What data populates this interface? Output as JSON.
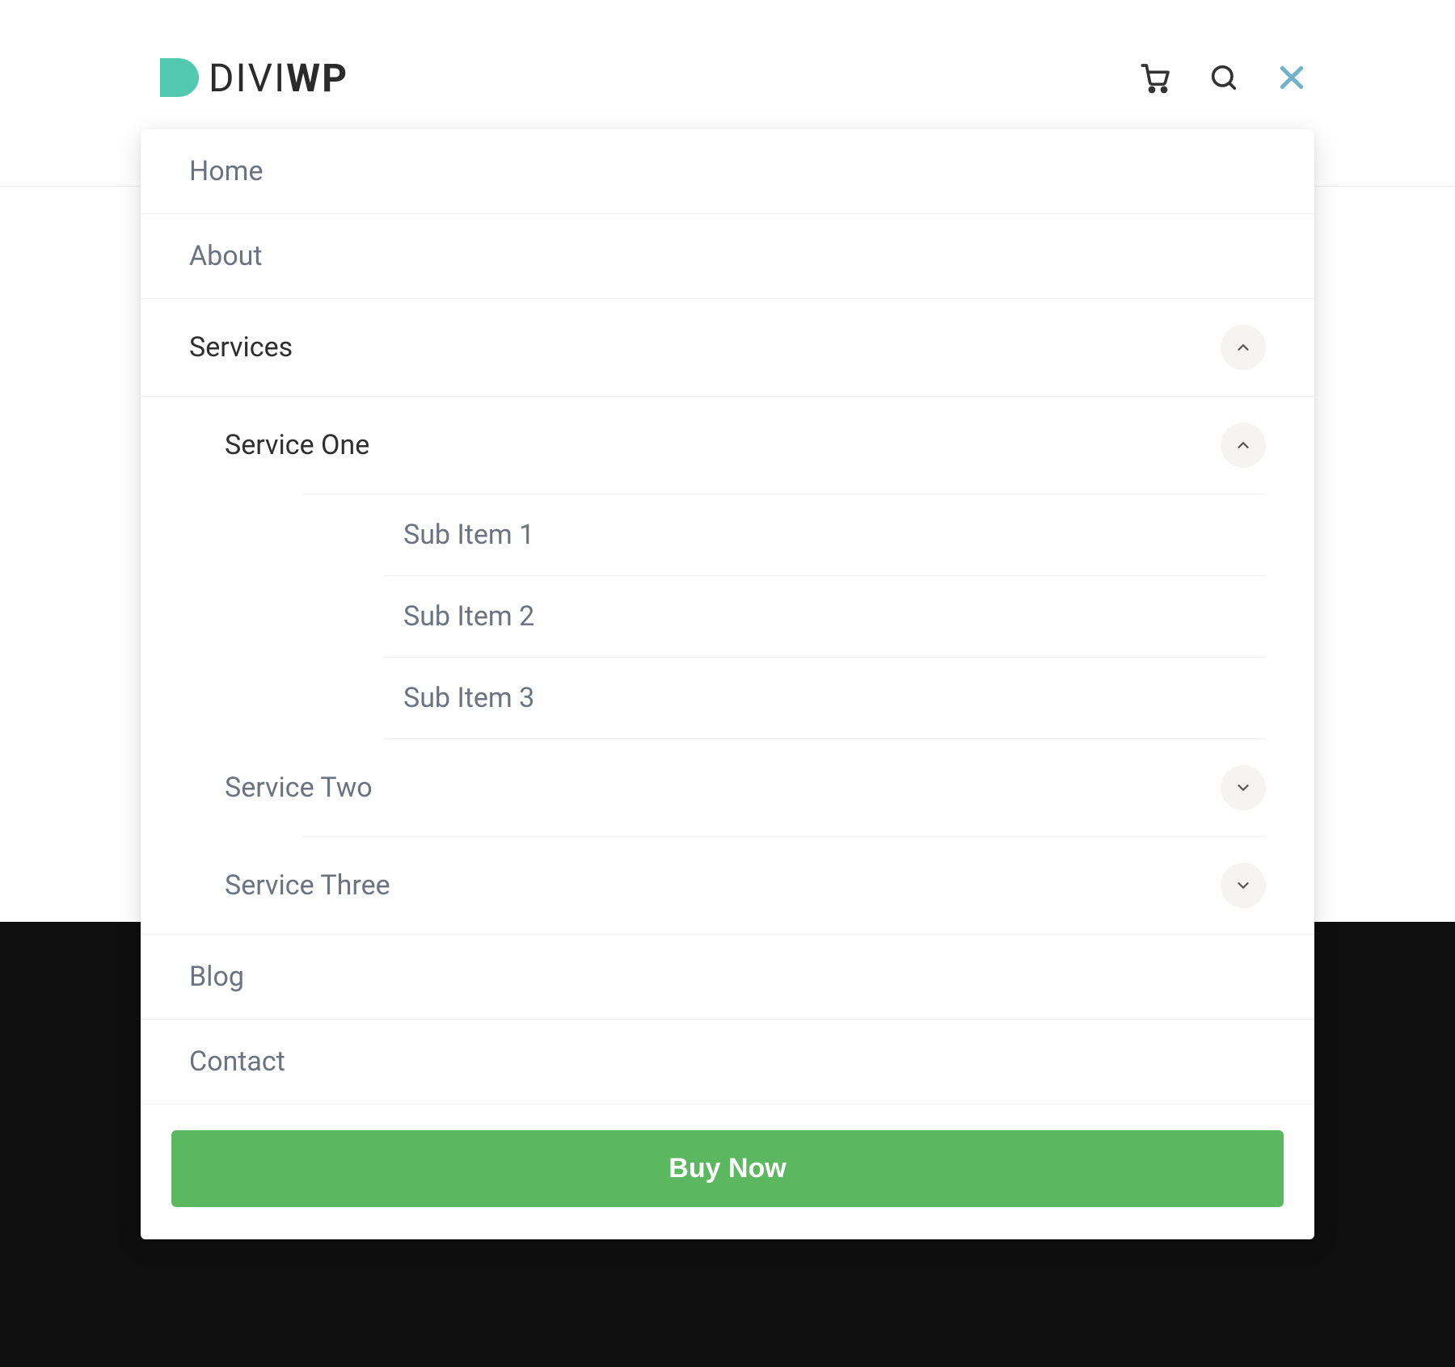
{
  "logo": {
    "divi": "DIVI",
    "wp": "WP"
  },
  "menu": {
    "home": "Home",
    "about": "About",
    "services": "Services",
    "service_one": "Service One",
    "sub_items": [
      "Sub Item 1",
      "Sub Item 2",
      "Sub Item 3"
    ],
    "service_two": "Service Two",
    "service_three": "Service Three",
    "blog": "Blog",
    "contact": "Contact"
  },
  "cta": {
    "buy_now": "Buy Now"
  },
  "colors": {
    "accent": "#5cb85c",
    "teal": "#52c9b0",
    "close": "#6fb2cd",
    "text": "#6b7280",
    "text_dark": "#2e2e2e"
  }
}
